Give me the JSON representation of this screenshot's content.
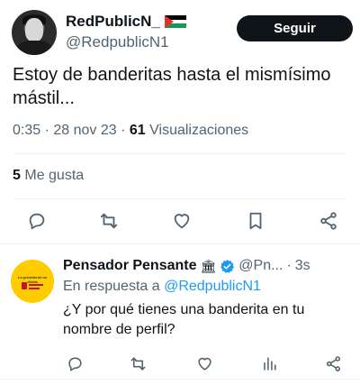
{
  "tweet": {
    "display_name": "RedPublicN_",
    "handle": "@RedpublicN1",
    "follow_label": "Seguir",
    "text": "Estoy de banderitas hasta el mismísimo mástil...",
    "time": "0:35",
    "date": "28 nov 23",
    "views_count": "61",
    "views_label": "Visualizaciones",
    "separator": "·",
    "likes_count": "5",
    "likes_label": "Me gusta",
    "actions": [
      "reply-icon",
      "retweet-icon",
      "like-icon",
      "bookmark-icon",
      "share-icon"
    ]
  },
  "reply": {
    "display_name": "Pensador Pensante",
    "badge": "🏛",
    "handle": "@Pn...",
    "separator": "·",
    "time": "3s",
    "reply_prefix": "En respuesta a",
    "reply_to": "@RedpublicN1",
    "text": "¿Y por qué tienes una banderita en tu nombre de perfil?",
    "avatar_text": "Lo presidente no divida",
    "actions": [
      "reply-icon",
      "retweet-icon",
      "like-icon",
      "views-icon",
      "share-icon"
    ]
  },
  "colors": {
    "text": "#0f1419",
    "secondary": "#536471",
    "link": "#1d9bf0",
    "verified": "#1d9bf0",
    "divider": "#eff3f4"
  }
}
